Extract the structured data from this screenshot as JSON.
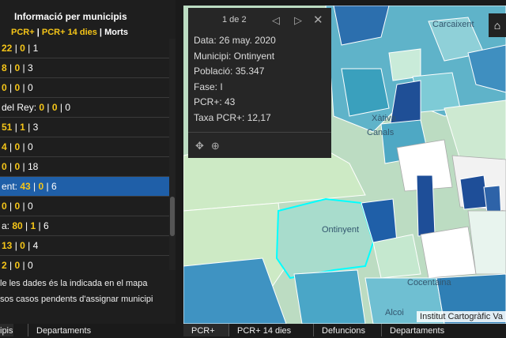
{
  "panel": {
    "title": "Informació per municipis",
    "legend": {
      "pcr": "PCR+",
      "sep1": " | ",
      "pcr14": "PCR+ 14 dies",
      "sep2": " | ",
      "morts": "Morts"
    }
  },
  "rows": [
    {
      "name": "",
      "pcr": "22",
      "pcr14": "0",
      "morts": "1"
    },
    {
      "name": "",
      "pcr": "8",
      "pcr14": "0",
      "morts": "3"
    },
    {
      "name": "",
      "pcr": "0",
      "pcr14": "0",
      "morts": "0"
    },
    {
      "name": "del Rey: ",
      "pcr": "0",
      "pcr14": "0",
      "morts": "0"
    },
    {
      "name": "",
      "pcr": "51",
      "pcr14": "1",
      "morts": "3"
    },
    {
      "name": "",
      "pcr": "4",
      "pcr14": "0",
      "morts": "0"
    },
    {
      "name": "",
      "pcr": "0",
      "pcr14": "0",
      "morts": "18"
    },
    {
      "name": "ent: ",
      "pcr": "43",
      "pcr14": "0",
      "morts": "6",
      "selected": true
    },
    {
      "name": "",
      "pcr": "0",
      "pcr14": "0",
      "morts": "0"
    },
    {
      "name": "a: ",
      "pcr": "80",
      "pcr14": "1",
      "morts": "6"
    },
    {
      "name": "",
      "pcr": "13",
      "pcr14": "0",
      "morts": "4"
    },
    {
      "name": "",
      "pcr": "2",
      "pcr14": "0",
      "morts": "0"
    }
  ],
  "notes": {
    "line1": "le les dades és la indicada en el mapa",
    "line2": "sos casos pendents d'assignar municipi"
  },
  "popup": {
    "page": "1 de 2",
    "fields": [
      "Data: 26 may. 2020",
      "Municipi: Ontinyent",
      "Població: 35.347",
      "Fase: I",
      "PCR+: 43",
      "Taxa PCR+: 12,17"
    ]
  },
  "map": {
    "labels": [
      "Carcaixent",
      "Xàtiva",
      "Canals",
      "Ontinyent",
      "Cocentaina",
      "Alcoi"
    ],
    "attribution": "Institut Cartogràfic Va"
  },
  "tabs_left": [
    "ipis",
    "Departaments"
  ],
  "tabs_right": [
    "PCR+",
    "PCR+ 14 dies",
    "Defuncions",
    "Departaments"
  ]
}
